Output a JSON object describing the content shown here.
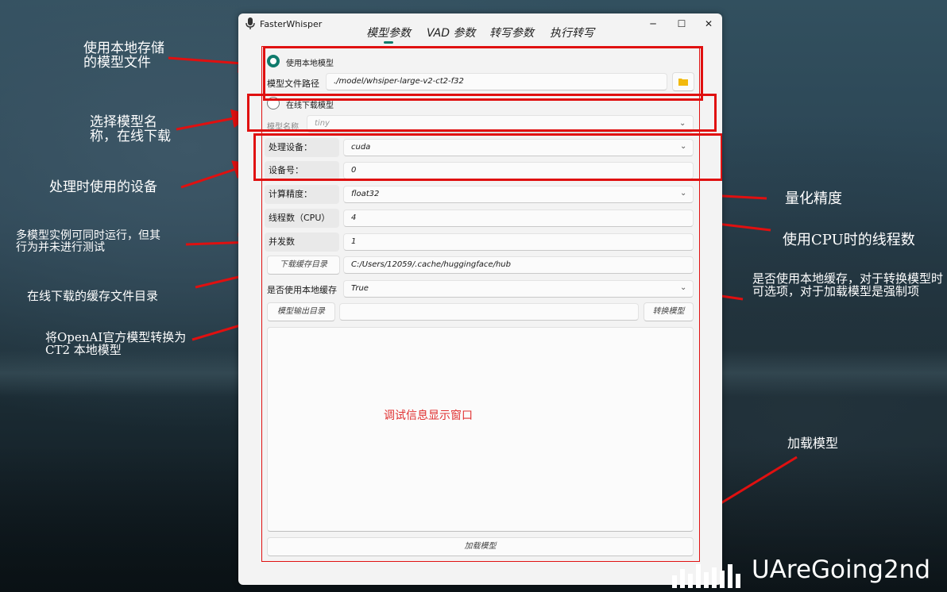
{
  "window": {
    "title": "FasterWhisper",
    "minimize": "─",
    "maximize": "☐",
    "close": "✕"
  },
  "tabs": [
    "模型参数",
    "VAD 参数",
    "转写参数",
    "执行转写"
  ],
  "model": {
    "local_radio_label": "使用本地模型",
    "path_label": "模型文件路径",
    "path_value": "./model/whsiper-large-v2-ct2-f32",
    "online_radio_label": "在线下载模型",
    "name_label": "模型名称",
    "name_value": "tiny"
  },
  "settings": {
    "device_label": "处理设备：",
    "device_value": "cuda",
    "device_num_label": "设备号：",
    "device_num_value": "0",
    "precision_label": "计算精度：",
    "precision_value": "float32",
    "threads_label": "线程数（CPU）",
    "threads_value": "4",
    "concurrency_label": "并发数",
    "concurrency_value": "1",
    "cache_dir_button": "下载缓存目录",
    "cache_dir_value": "C:/Users/12059/.cache/huggingface/hub",
    "use_cache_label": "是否使用本地缓存",
    "use_cache_value": "True",
    "output_dir_button": "模型输出目录",
    "output_dir_value": "",
    "convert_button": "转换模型",
    "load_button": "加载模型"
  },
  "log_area_text": "调试信息显示窗口",
  "annotations": {
    "local_model": "使用本地存储的模型文件",
    "online_model": "选择模型名称，在线下载",
    "device": "处理时使用的设备",
    "concurrency": "多模型实例可同时运行，但其行为并未进行测试",
    "cache_dir": "在线下载的缓存文件目录",
    "convert": "将OpenAI官方模型转换为CT2 本地模型",
    "precision": "量化精度",
    "threads": "使用CPU时的线程数",
    "use_cache": "是否使用本地缓存，对于转换模型时可选项，对于加载模型是强制项",
    "load": "加载模型"
  },
  "watermark": "UAreGoing2nd",
  "colors": {
    "annotation_red": "#e01010",
    "accent_teal": "#0f7b6c",
    "log_text": "#e03030"
  },
  "icons": [
    "microphone-icon",
    "folder-icon",
    "chevron-down-icon"
  ]
}
